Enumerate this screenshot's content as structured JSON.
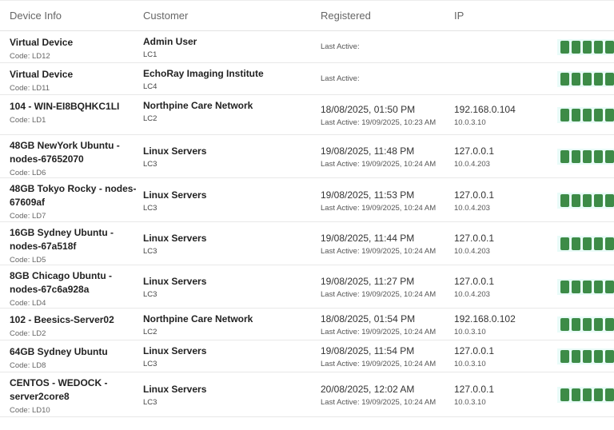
{
  "header": {
    "device_info": "Device Info",
    "customer": "Customer",
    "registered": "Registered",
    "ip": "IP"
  },
  "rows": [
    {
      "device": [
        "Virtual Device"
      ],
      "code": "Code: LD12",
      "customer": "Admin User",
      "cust_code": "LC1",
      "registered": "",
      "last_active": "Last Active:",
      "ip": "",
      "ip_sub": "",
      "bars": 5
    },
    {
      "device": [
        "Virtual Device"
      ],
      "code": "Code: LD11",
      "customer": "EchoRay Imaging Institute",
      "cust_code": "LC4",
      "registered": "",
      "last_active": "Last Active:",
      "ip": "",
      "ip_sub": "",
      "bars": 5
    },
    {
      "device": [
        "104 - WIN-EI8BQHKC1LI"
      ],
      "code": "Code: LD1",
      "customer": "Northpine Care Network",
      "cust_code": "LC2",
      "registered": "18/08/2025, 01:50 PM",
      "last_active": "Last Active: 19/09/2025, 10:23 AM",
      "ip": "192.168.0.104",
      "ip_sub": "10.0.3.10",
      "bars": 5
    },
    {
      "device": [
        "48GB NewYork Ubuntu -",
        "nodes-67652070"
      ],
      "code": "Code: LD6",
      "customer": "Linux Servers",
      "cust_code": "LC3",
      "registered": "19/08/2025, 11:48 PM",
      "last_active": "Last Active: 19/09/2025, 10:24 AM",
      "ip": "127.0.0.1",
      "ip_sub": "10.0.4.203",
      "bars": 5
    },
    {
      "device": [
        "48GB Tokyo Rocky - nodes-",
        "67609af"
      ],
      "code": "Code: LD7",
      "customer": "Linux Servers",
      "cust_code": "LC3",
      "registered": "19/08/2025, 11:53 PM",
      "last_active": "Last Active: 19/09/2025, 10:24 AM",
      "ip": "127.0.0.1",
      "ip_sub": "10.0.4.203",
      "bars": 5
    },
    {
      "device": [
        "16GB Sydney Ubuntu -",
        "nodes-67a518f"
      ],
      "code": "Code: LD5",
      "customer": "Linux Servers",
      "cust_code": "LC3",
      "registered": "19/08/2025, 11:44 PM",
      "last_active": "Last Active: 19/09/2025, 10:24 AM",
      "ip": "127.0.0.1",
      "ip_sub": "10.0.4.203",
      "bars": 5
    },
    {
      "device": [
        "8GB Chicago Ubuntu -",
        "nodes-67c6a928a"
      ],
      "code": "Code: LD4",
      "customer": "Linux Servers",
      "cust_code": "LC3",
      "registered": "19/08/2025, 11:27 PM",
      "last_active": "Last Active: 19/09/2025, 10:24 AM",
      "ip": "127.0.0.1",
      "ip_sub": "10.0.4.203",
      "bars": 5
    },
    {
      "device": [
        "102 - Beesics-Server02"
      ],
      "code": "Code: LD2",
      "customer": "Northpine Care Network",
      "cust_code": "LC2",
      "registered": "18/08/2025, 01:54 PM",
      "last_active": "Last Active: 19/09/2025, 10:24 AM",
      "ip": "192.168.0.102",
      "ip_sub": "10.0.3.10",
      "bars": 5
    },
    {
      "device": [
        "64GB Sydney Ubuntu"
      ],
      "code": "Code: LD8",
      "customer": "Linux Servers",
      "cust_code": "LC3",
      "registered": "19/08/2025, 11:54 PM",
      "last_active": "Last Active: 19/09/2025, 10:24 AM",
      "ip": "127.0.0.1",
      "ip_sub": "10.0.3.10",
      "bars": 5
    },
    {
      "device": [
        "CENTOS - WEDOCK -",
        "server2core8"
      ],
      "code": "Code: LD10",
      "customer": "Linux Servers",
      "cust_code": "LC3",
      "registered": "20/08/2025, 12:02 AM",
      "last_active": "Last Active: 19/09/2025, 10:24 AM",
      "ip": "127.0.0.1",
      "ip_sub": "10.0.3.10",
      "bars": 5
    }
  ]
}
